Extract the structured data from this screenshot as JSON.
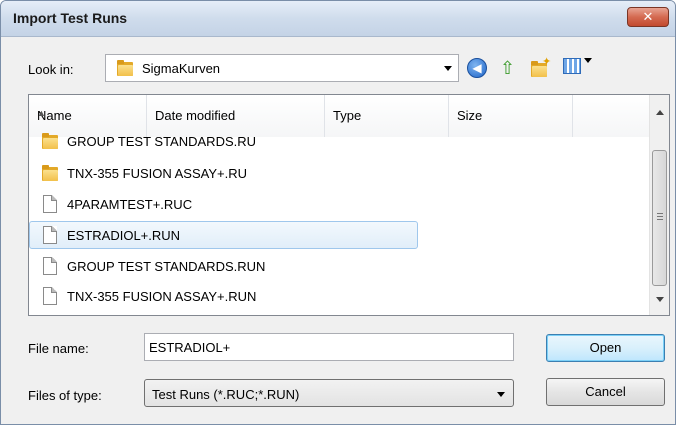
{
  "window": {
    "title": "Import Test Runs",
    "close_glyph": "✕"
  },
  "look_in": {
    "label": "Look in:",
    "value": "SigmaKurven",
    "icon": "folder-icon"
  },
  "toolbar": {
    "icons": [
      "back-icon",
      "up-folder-icon",
      "new-folder-icon",
      "view-menu-icon"
    ]
  },
  "file_list": {
    "columns": [
      "Name",
      "Date modified",
      "Type",
      "Size"
    ],
    "rows": [
      {
        "name": "GROUP TEST STANDARDS.RU",
        "icon": "folder-icon",
        "selected": false
      },
      {
        "name": "TNX-355 FUSION ASSAY+.RU",
        "icon": "folder-icon",
        "selected": false
      },
      {
        "name": "4PARAMTEST+.RUC",
        "icon": "file-icon",
        "selected": false
      },
      {
        "name": "ESTRADIOL+.RUN",
        "icon": "file-icon",
        "selected": true
      },
      {
        "name": "GROUP TEST STANDARDS.RUN",
        "icon": "file-icon",
        "selected": false
      },
      {
        "name": "TNX-355 FUSION ASSAY+.RUN",
        "icon": "file-icon",
        "selected": false
      }
    ]
  },
  "file_name": {
    "label": "File name:",
    "value": "ESTRADIOL+"
  },
  "file_type": {
    "label": "Files of type:",
    "value": "Test Runs (*.RUC;*.RUN)"
  },
  "buttons": {
    "open": "Open",
    "cancel": "Cancel"
  },
  "colors": {
    "selection": "#e1eef9",
    "close_button": "#d46a51"
  }
}
